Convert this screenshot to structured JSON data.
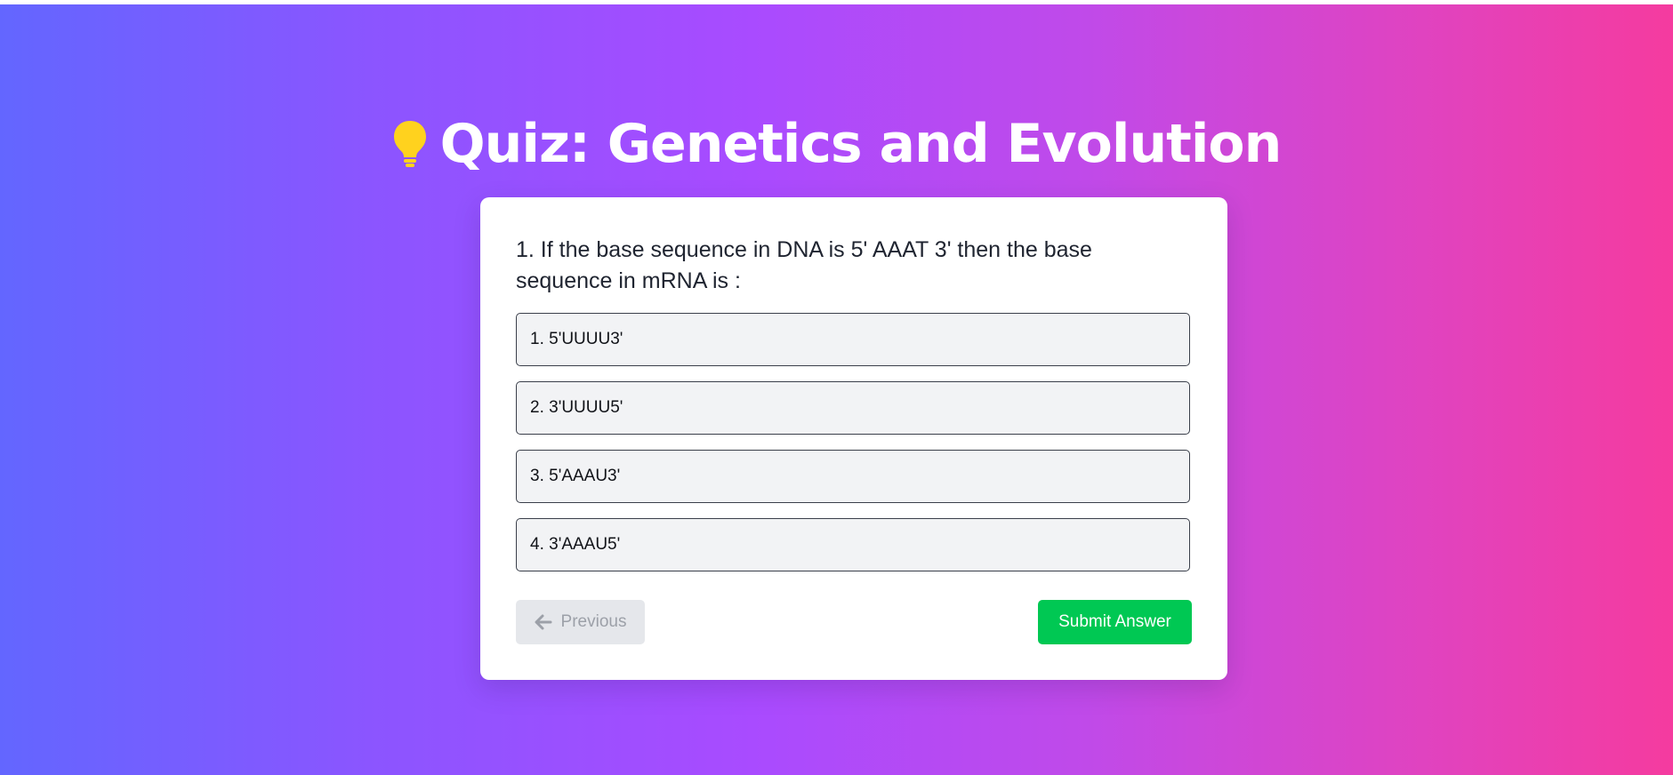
{
  "header": {
    "icon": "lightbulb-icon",
    "title": "Quiz: Genetics and Evolution"
  },
  "quiz": {
    "question": "1. If the base sequence in DNA is 5' AAAT 3' then the base sequence in mRNA is :",
    "options": [
      {
        "label": "1. 5'UUUU3'"
      },
      {
        "label": "2. 3'UUUU5'"
      },
      {
        "label": "3. 5'AAAU3'"
      },
      {
        "label": "4. 3'AAAU5'"
      }
    ],
    "previous_label": "Previous",
    "previous_icon": "arrow-left-icon",
    "submit_label": "Submit Answer"
  },
  "colors": {
    "gradient_start": "#6366ff",
    "gradient_mid": "#a94bff",
    "gradient_end": "#f53b9f",
    "submit": "#00c853",
    "bulb": "#ffd21e"
  }
}
